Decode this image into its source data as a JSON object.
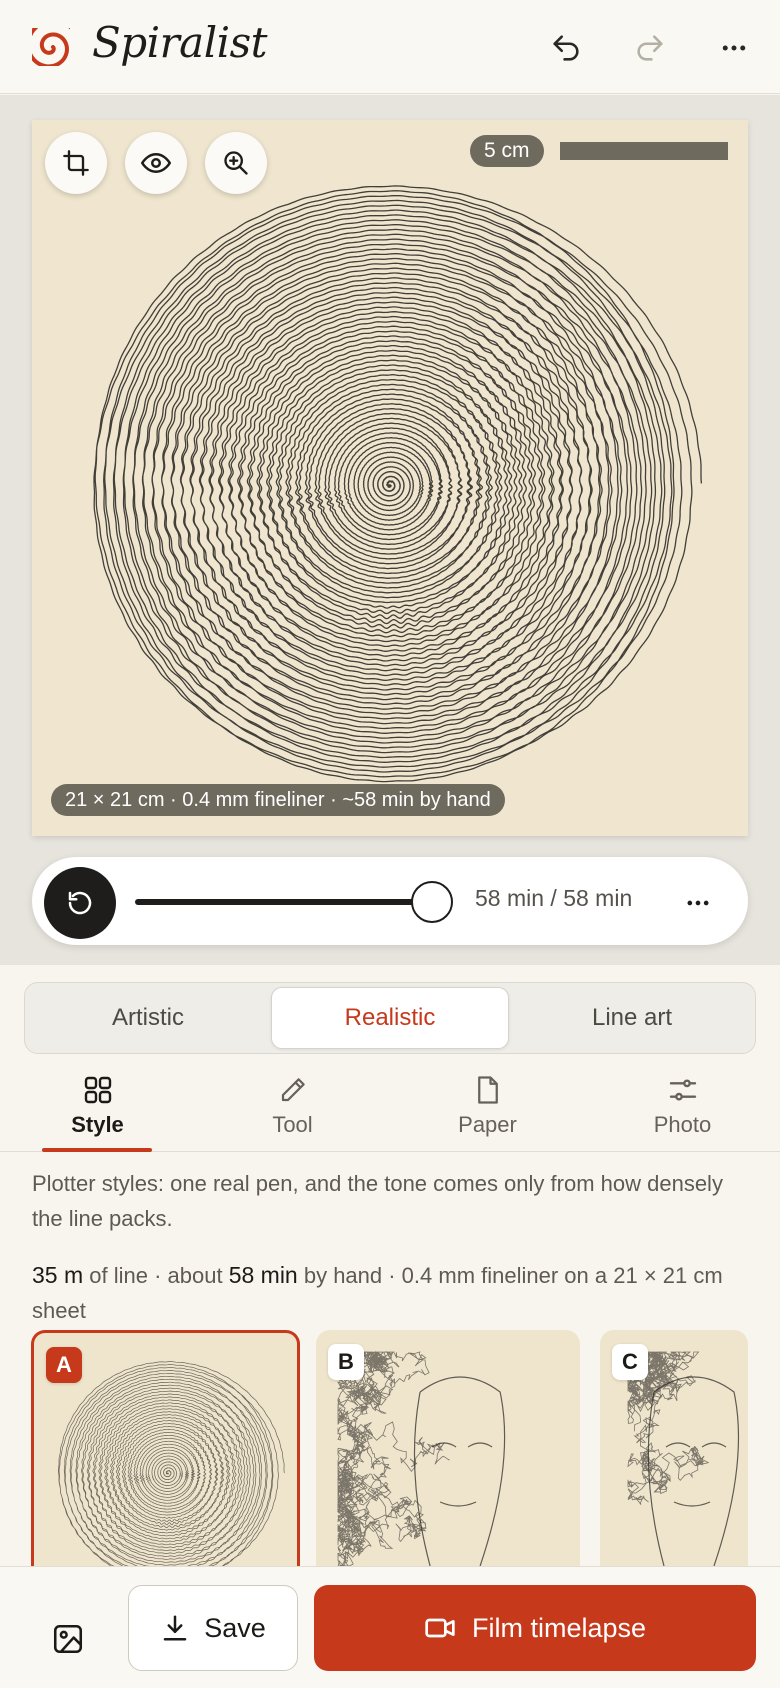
{
  "header": {
    "app_title": "Spiralist",
    "icons": [
      "spiral-logo-icon",
      "undo-icon",
      "redo-icon",
      "more-icon"
    ],
    "accent": "#c7391b"
  },
  "canvas": {
    "tools": [
      "crop-icon",
      "eye-icon",
      "zoom-in-icon"
    ],
    "scale_label": "5 cm",
    "info_label": "21 × 21 cm · 0.4 mm fineliner · ~58 min by hand",
    "paper_color": "#f0e6cf",
    "ink_color": "#2f2c28"
  },
  "player": {
    "time_label": "58 min / 58 min",
    "progress": 1.0
  },
  "modes": {
    "items": [
      {
        "label": "Artistic"
      },
      {
        "label": "Realistic"
      },
      {
        "label": "Line art"
      }
    ],
    "selected": "Realistic"
  },
  "tabs": {
    "items": [
      {
        "label": "Style",
        "icon": "grid-icon"
      },
      {
        "label": "Tool",
        "icon": "pencil-icon"
      },
      {
        "label": "Paper",
        "icon": "page-icon"
      },
      {
        "label": "Photo",
        "icon": "sliders-icon"
      }
    ],
    "selected": "Style"
  },
  "style_panel": {
    "description": "Plotter styles: one real pen, and the tone comes only from how densely the line packs.",
    "stats": {
      "length": "35 m",
      "of_line": " of line · about ",
      "time": "58 min",
      "rest": " by hand · 0.4 mm fineliner on a 21 × 21 cm sheet"
    },
    "cards": [
      {
        "letter": "A",
        "style": "spiral"
      },
      {
        "letter": "B",
        "style": "scribble"
      },
      {
        "letter": "C",
        "style": "scribble"
      }
    ],
    "selected_card": "A"
  },
  "footer": {
    "save_label": "Save",
    "film_label": "Film timelapse",
    "icons": [
      "image-icon",
      "download-icon",
      "video-icon"
    ]
  }
}
